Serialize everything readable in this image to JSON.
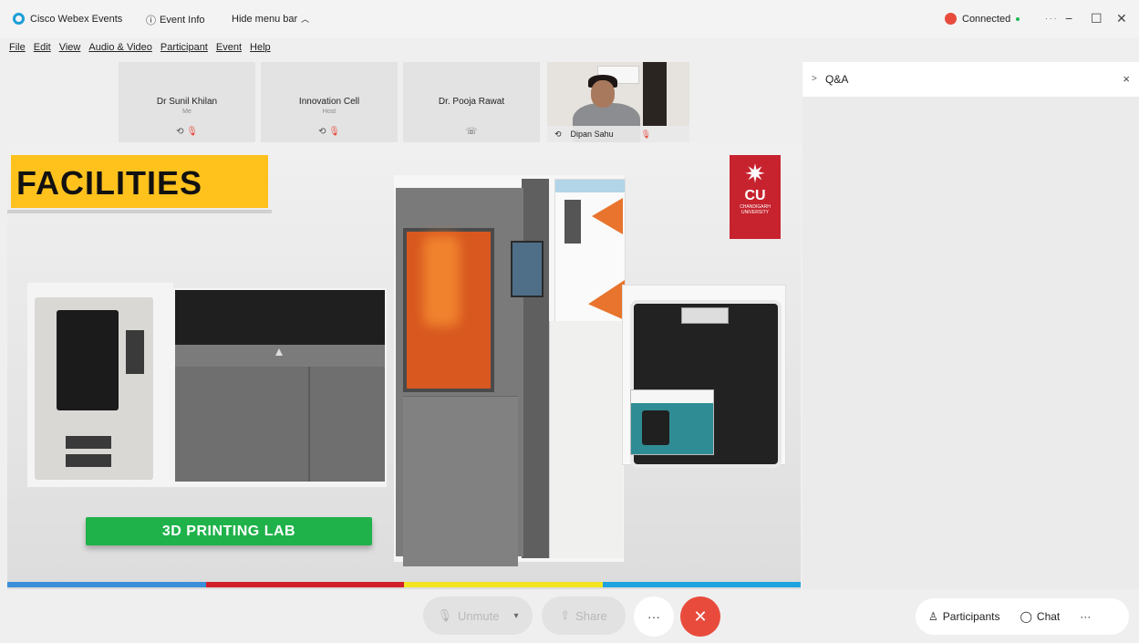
{
  "window": {
    "app_name": "Cisco Webex Events",
    "event_info": "Event Info",
    "hide_menu": "Hide menu bar",
    "status": "Connected"
  },
  "menu": [
    "File",
    "Edit",
    "View",
    "Audio & Video",
    "Participant",
    "Event",
    "Help"
  ],
  "participants": [
    {
      "name": "Dr Sunil Khilan",
      "sub": "Me"
    },
    {
      "name": "Innovation Cell",
      "sub": "Host"
    },
    {
      "name": "Dr. Pooja Rawat",
      "sub": ""
    }
  ],
  "video_participant": {
    "name": "Dipan Sahu"
  },
  "slide": {
    "heading": "FACILITIES",
    "logo_text": "CU",
    "logo_sub": "CHANDIGARH UNIVERSITY",
    "lab_label": "3D PRINTING LAB",
    "bar_colors": [
      "#3b8fd9",
      "#d21f2b",
      "#f2e421",
      "#1fa3e0"
    ]
  },
  "panel": {
    "title": "Q&A"
  },
  "controls": {
    "unmute": "Unmute",
    "share": "Share",
    "participants": "Participants",
    "chat": "Chat"
  }
}
